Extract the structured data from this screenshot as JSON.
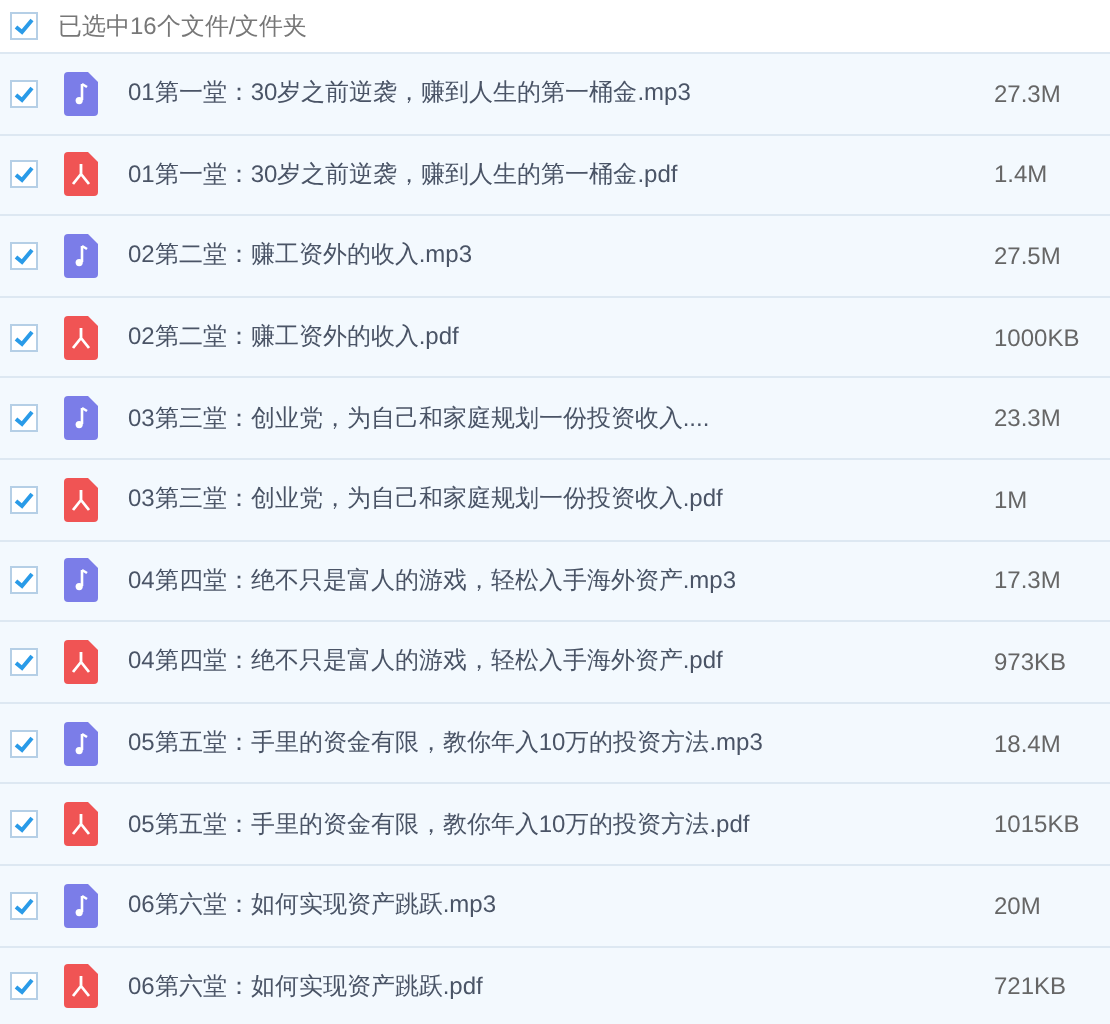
{
  "header": {
    "checked": true,
    "label": "已选中16个文件/文件夹"
  },
  "files": [
    {
      "kind": "audio",
      "checked": true,
      "name": "01第一堂：30岁之前逆袭，赚到人生的第一桶金.mp3",
      "size": "27.3M"
    },
    {
      "kind": "pdf",
      "checked": true,
      "name": "01第一堂：30岁之前逆袭，赚到人生的第一桶金.pdf",
      "size": "1.4M"
    },
    {
      "kind": "audio",
      "checked": true,
      "name": "02第二堂：赚工资外的收入.mp3",
      "size": "27.5M"
    },
    {
      "kind": "pdf",
      "checked": true,
      "name": "02第二堂：赚工资外的收入.pdf",
      "size": "1000KB"
    },
    {
      "kind": "audio",
      "checked": true,
      "name": "03第三堂：创业党，为自己和家庭规划一份投资收入....",
      "size": "23.3M"
    },
    {
      "kind": "pdf",
      "checked": true,
      "name": "03第三堂：创业党，为自己和家庭规划一份投资收入.pdf",
      "size": "1M"
    },
    {
      "kind": "audio",
      "checked": true,
      "name": "04第四堂：绝不只是富人的游戏，轻松入手海外资产.mp3",
      "size": "17.3M"
    },
    {
      "kind": "pdf",
      "checked": true,
      "name": "04第四堂：绝不只是富人的游戏，轻松入手海外资产.pdf",
      "size": "973KB"
    },
    {
      "kind": "audio",
      "checked": true,
      "name": "05第五堂：手里的资金有限，教你年入10万的投资方法.mp3",
      "size": "18.4M"
    },
    {
      "kind": "pdf",
      "checked": true,
      "name": "05第五堂：手里的资金有限，教你年入10万的投资方法.pdf",
      "size": "1015KB"
    },
    {
      "kind": "audio",
      "checked": true,
      "name": "06第六堂：如何实现资产跳跃.mp3",
      "size": "20M"
    },
    {
      "kind": "pdf",
      "checked": true,
      "name": "06第六堂：如何实现资产跳跃.pdf",
      "size": "721KB"
    }
  ]
}
